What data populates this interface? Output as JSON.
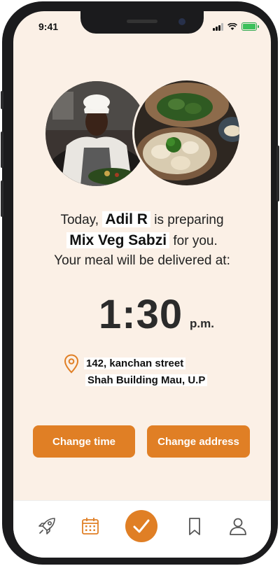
{
  "status_bar": {
    "time": "9:41"
  },
  "images": {
    "chef_alt": "chef cooking",
    "food_alt": "dumplings"
  },
  "message": {
    "prefix": "Today,",
    "cook_name": "Adil R",
    "middle": "is preparing",
    "dish_name": "Mix Veg Sabzi",
    "suffix": "for you.",
    "delivery_line": "Your meal will be delivered at:"
  },
  "delivery": {
    "time": "1:30",
    "period": "p.m."
  },
  "address": {
    "line1": "142, kanchan street",
    "line2": "Shah Building Mau, U.P"
  },
  "actions": {
    "change_time": "Change time",
    "change_address": "Change address"
  },
  "bottom_nav": {
    "items": [
      "rocket-icon",
      "calendar-icon",
      "check-icon",
      "bookmark-icon",
      "user-icon"
    ],
    "active": "check-icon"
  },
  "colors": {
    "accent": "#e07f25",
    "background": "#fbf0e6",
    "battery": "#3cc05a"
  }
}
